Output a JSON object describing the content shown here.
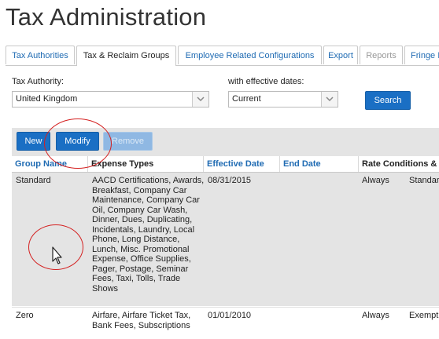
{
  "page": {
    "title": "Tax Administration"
  },
  "tabs": [
    {
      "label": "Tax Authorities",
      "state": "link"
    },
    {
      "label": "Tax & Reclaim Groups",
      "state": "active"
    },
    {
      "label": "Employee Related Configurations",
      "state": "link"
    },
    {
      "label": "Export",
      "state": "link"
    },
    {
      "label": "Reports",
      "state": "disabled"
    },
    {
      "label": "Fringe I",
      "state": "link"
    }
  ],
  "filters": {
    "tax_authority_label": "Tax Authority:",
    "tax_authority_value": "United Kingdom",
    "effective_dates_label": "with effective dates:",
    "effective_dates_value": "Current",
    "search_label": "Search"
  },
  "toolbar": {
    "new_label": "New",
    "modify_label": "Modify",
    "remove_label": "Remove"
  },
  "grid": {
    "columns": [
      "Group Name",
      "Expense Types",
      "Effective Date",
      "End Date",
      "Rate Conditions & I"
    ],
    "rows": [
      {
        "group_name": "Standard",
        "expense_types": "AACD Certifications, Awards, Breakfast, Company Car Maintenance, Company Car Oil, Company Car Wash, Dinner, Dues, Duplicating, Incidentals, Laundry, Local Phone, Long Distance, Lunch, Misc. Promotional Expense, Office Supplies, Pager, Postage, Seminar Fees, Taxi, Tolls, Trade Shows",
        "effective_date": "08/31/2015",
        "end_date": "",
        "condition": "Always",
        "rate": "Standar",
        "selected": true
      },
      {
        "group_name": "Zero",
        "expense_types": "Airfare, Airfare Ticket Tax, Bank Fees, Subscriptions",
        "effective_date": "01/01/2010",
        "end_date": "",
        "condition": "Always",
        "rate": "Exempt",
        "selected": false
      }
    ]
  },
  "colors": {
    "accent": "#1a6fc4",
    "link": "#1f6bb3",
    "annotation": "#d42020",
    "selected_row": "#e4e4e4"
  },
  "icons": {
    "dropdown": "chevron-down-icon",
    "cursor": "mouse-pointer-icon"
  }
}
